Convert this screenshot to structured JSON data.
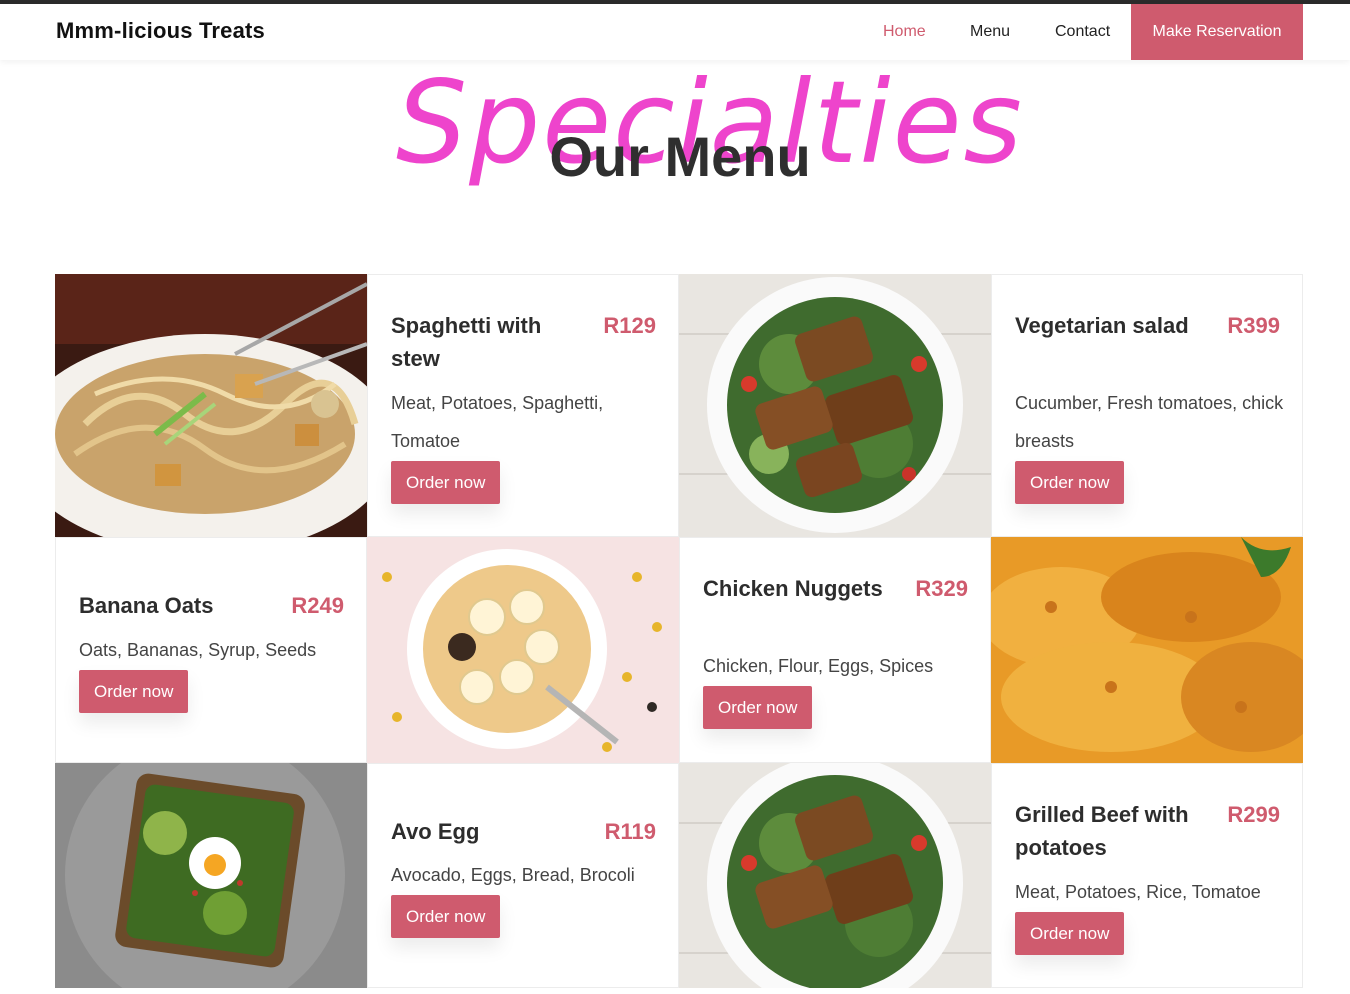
{
  "header": {
    "brand": "Mmm-licious Treats",
    "nav": [
      "Home",
      "Menu",
      "Contact"
    ],
    "cta": "Make Reservation"
  },
  "hero": {
    "script_title": "Specialties",
    "title": "Our Menu"
  },
  "colors": {
    "accent": "#cf5b6e",
    "script": "#ee44cc",
    "text": "#2d2d2d"
  },
  "menu": [
    {
      "name": "Spaghetti with stew",
      "price": "R129",
      "description": "Meat, Potatoes, Spaghetti, Tomatoe",
      "button": "Order now",
      "image": "noodle-stir-fry-photo"
    },
    {
      "name": "Vegetarian salad",
      "price": "R399",
      "description": "Cucumber, Fresh tomatoes, chick breasts",
      "button": "Order now",
      "image": "grilled-chicken-salad-photo"
    },
    {
      "name": "Banana Oats",
      "price": "R249",
      "description": "Oats, Bananas, Syrup, Seeds",
      "button": "Order now",
      "image": "banana-oats-bowl-photo"
    },
    {
      "name": "Chicken Nuggets",
      "price": "R329",
      "description": "Chicken, Flour, Eggs, Spices",
      "button": "Order now",
      "image": "fried-chicken-photo"
    },
    {
      "name": "Avo Egg",
      "price": "R119",
      "description": "Avocado, Eggs, Bread, Brocoli",
      "button": "Order now",
      "image": "avocado-toast-photo"
    },
    {
      "name": "Grilled Beef with potatoes",
      "price": "R299",
      "description": "Meat, Potatoes, Rice, Tomatoe",
      "button": "Order now",
      "image": "grilled-chicken-salad-photo"
    }
  ]
}
